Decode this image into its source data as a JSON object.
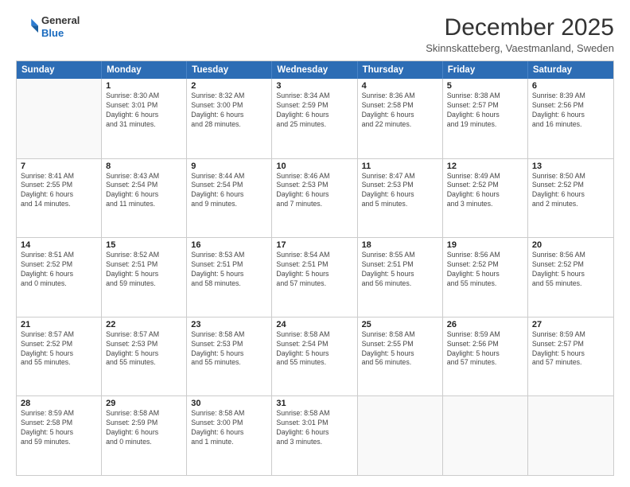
{
  "header": {
    "logo_line1": "General",
    "logo_line2": "Blue",
    "month": "December 2025",
    "location": "Skinnskatteberg, Vaestmanland, Sweden"
  },
  "days": [
    "Sunday",
    "Monday",
    "Tuesday",
    "Wednesday",
    "Thursday",
    "Friday",
    "Saturday"
  ],
  "weeks": [
    [
      {
        "day": "",
        "info": ""
      },
      {
        "day": "1",
        "info": "Sunrise: 8:30 AM\nSunset: 3:01 PM\nDaylight: 6 hours\nand 31 minutes."
      },
      {
        "day": "2",
        "info": "Sunrise: 8:32 AM\nSunset: 3:00 PM\nDaylight: 6 hours\nand 28 minutes."
      },
      {
        "day": "3",
        "info": "Sunrise: 8:34 AM\nSunset: 2:59 PM\nDaylight: 6 hours\nand 25 minutes."
      },
      {
        "day": "4",
        "info": "Sunrise: 8:36 AM\nSunset: 2:58 PM\nDaylight: 6 hours\nand 22 minutes."
      },
      {
        "day": "5",
        "info": "Sunrise: 8:38 AM\nSunset: 2:57 PM\nDaylight: 6 hours\nand 19 minutes."
      },
      {
        "day": "6",
        "info": "Sunrise: 8:39 AM\nSunset: 2:56 PM\nDaylight: 6 hours\nand 16 minutes."
      }
    ],
    [
      {
        "day": "7",
        "info": "Sunrise: 8:41 AM\nSunset: 2:55 PM\nDaylight: 6 hours\nand 14 minutes."
      },
      {
        "day": "8",
        "info": "Sunrise: 8:43 AM\nSunset: 2:54 PM\nDaylight: 6 hours\nand 11 minutes."
      },
      {
        "day": "9",
        "info": "Sunrise: 8:44 AM\nSunset: 2:54 PM\nDaylight: 6 hours\nand 9 minutes."
      },
      {
        "day": "10",
        "info": "Sunrise: 8:46 AM\nSunset: 2:53 PM\nDaylight: 6 hours\nand 7 minutes."
      },
      {
        "day": "11",
        "info": "Sunrise: 8:47 AM\nSunset: 2:53 PM\nDaylight: 6 hours\nand 5 minutes."
      },
      {
        "day": "12",
        "info": "Sunrise: 8:49 AM\nSunset: 2:52 PM\nDaylight: 6 hours\nand 3 minutes."
      },
      {
        "day": "13",
        "info": "Sunrise: 8:50 AM\nSunset: 2:52 PM\nDaylight: 6 hours\nand 2 minutes."
      }
    ],
    [
      {
        "day": "14",
        "info": "Sunrise: 8:51 AM\nSunset: 2:52 PM\nDaylight: 6 hours\nand 0 minutes."
      },
      {
        "day": "15",
        "info": "Sunrise: 8:52 AM\nSunset: 2:51 PM\nDaylight: 5 hours\nand 59 minutes."
      },
      {
        "day": "16",
        "info": "Sunrise: 8:53 AM\nSunset: 2:51 PM\nDaylight: 5 hours\nand 58 minutes."
      },
      {
        "day": "17",
        "info": "Sunrise: 8:54 AM\nSunset: 2:51 PM\nDaylight: 5 hours\nand 57 minutes."
      },
      {
        "day": "18",
        "info": "Sunrise: 8:55 AM\nSunset: 2:51 PM\nDaylight: 5 hours\nand 56 minutes."
      },
      {
        "day": "19",
        "info": "Sunrise: 8:56 AM\nSunset: 2:52 PM\nDaylight: 5 hours\nand 55 minutes."
      },
      {
        "day": "20",
        "info": "Sunrise: 8:56 AM\nSunset: 2:52 PM\nDaylight: 5 hours\nand 55 minutes."
      }
    ],
    [
      {
        "day": "21",
        "info": "Sunrise: 8:57 AM\nSunset: 2:52 PM\nDaylight: 5 hours\nand 55 minutes."
      },
      {
        "day": "22",
        "info": "Sunrise: 8:57 AM\nSunset: 2:53 PM\nDaylight: 5 hours\nand 55 minutes."
      },
      {
        "day": "23",
        "info": "Sunrise: 8:58 AM\nSunset: 2:53 PM\nDaylight: 5 hours\nand 55 minutes."
      },
      {
        "day": "24",
        "info": "Sunrise: 8:58 AM\nSunset: 2:54 PM\nDaylight: 5 hours\nand 55 minutes."
      },
      {
        "day": "25",
        "info": "Sunrise: 8:58 AM\nSunset: 2:55 PM\nDaylight: 5 hours\nand 56 minutes."
      },
      {
        "day": "26",
        "info": "Sunrise: 8:59 AM\nSunset: 2:56 PM\nDaylight: 5 hours\nand 57 minutes."
      },
      {
        "day": "27",
        "info": "Sunrise: 8:59 AM\nSunset: 2:57 PM\nDaylight: 5 hours\nand 57 minutes."
      }
    ],
    [
      {
        "day": "28",
        "info": "Sunrise: 8:59 AM\nSunset: 2:58 PM\nDaylight: 5 hours\nand 59 minutes."
      },
      {
        "day": "29",
        "info": "Sunrise: 8:58 AM\nSunset: 2:59 PM\nDaylight: 6 hours\nand 0 minutes."
      },
      {
        "day": "30",
        "info": "Sunrise: 8:58 AM\nSunset: 3:00 PM\nDaylight: 6 hours\nand 1 minute."
      },
      {
        "day": "31",
        "info": "Sunrise: 8:58 AM\nSunset: 3:01 PM\nDaylight: 6 hours\nand 3 minutes."
      },
      {
        "day": "",
        "info": ""
      },
      {
        "day": "",
        "info": ""
      },
      {
        "day": "",
        "info": ""
      }
    ]
  ]
}
